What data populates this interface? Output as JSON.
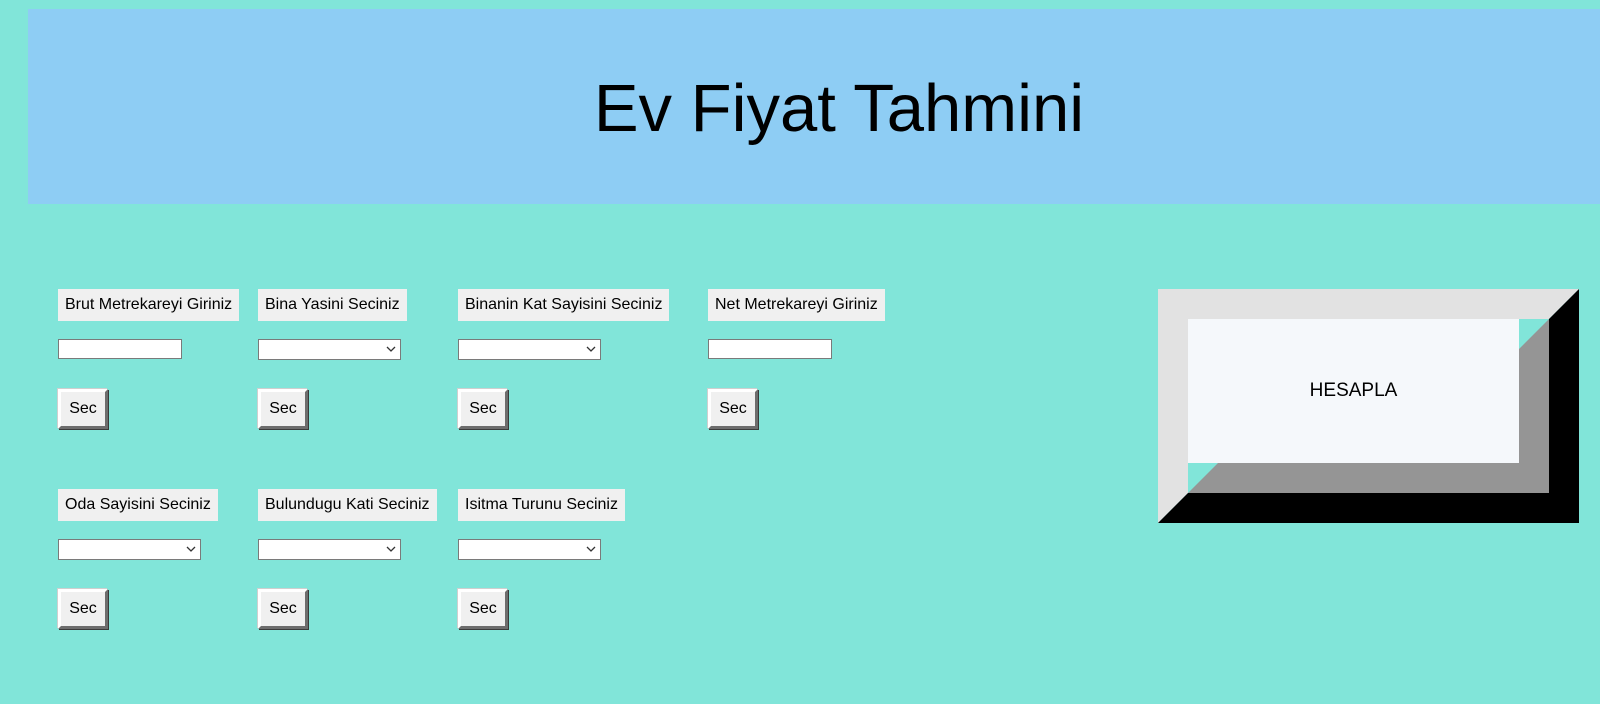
{
  "header": {
    "title": "Ev Fiyat Tahmini",
    "background": "#8ecdf4"
  },
  "page": {
    "background": "#81e5d9"
  },
  "fields": {
    "brut_metrekare": {
      "label": "Brut Metrekareyi Giriniz",
      "value": "",
      "button_label": "Sec"
    },
    "bina_yasi": {
      "label": "Bina Yasini Seciniz",
      "selected": "",
      "button_label": "Sec"
    },
    "kat_sayisi": {
      "label": "Binanin Kat Sayisini Seciniz",
      "selected": "",
      "button_label": "Sec"
    },
    "net_metrekare": {
      "label": "Net Metrekareyi Giriniz",
      "value": "",
      "button_label": "Sec"
    },
    "oda_sayisi": {
      "label": "Oda Sayisini Seciniz",
      "selected": "",
      "button_label": "Sec"
    },
    "bulundugu_kat": {
      "label": "Bulundugu Kati Seciniz",
      "selected": "",
      "button_label": "Sec"
    },
    "isitma_turu": {
      "label": "Isitma Turunu Seciniz",
      "selected": "",
      "button_label": "Sec"
    }
  },
  "actions": {
    "hesapla_label": "HESAPLA"
  },
  "icons": {
    "dropdown": "chevron-down-icon"
  }
}
